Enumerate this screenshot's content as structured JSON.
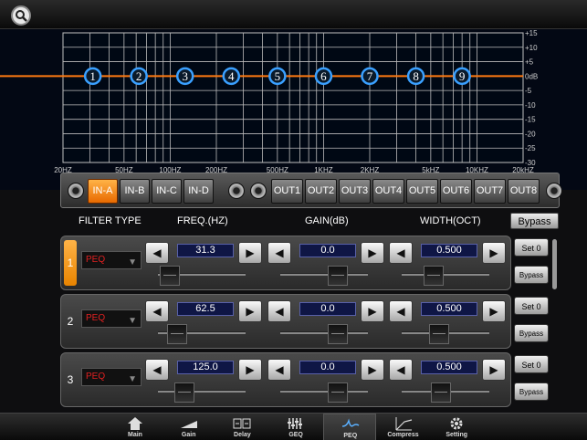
{
  "graph": {
    "db_labels": [
      "+15",
      "+10",
      "+5",
      "0dB",
      "-5",
      "-10",
      "-15",
      "-20",
      "-25",
      "-30"
    ],
    "freq_labels": [
      {
        "label": "20HZ",
        "f": 20
      },
      {
        "label": "50HZ",
        "f": 50
      },
      {
        "label": "100HZ",
        "f": 100
      },
      {
        "label": "200HZ",
        "f": 200
      },
      {
        "label": "500HZ",
        "f": 500
      },
      {
        "label": "1KHZ",
        "f": 1000
      },
      {
        "label": "2KHZ",
        "f": 2000
      },
      {
        "label": "5kHZ",
        "f": 5000
      },
      {
        "label": "10KHZ",
        "f": 10000
      },
      {
        "label": "20kHZ",
        "f": 20000
      }
    ],
    "curve_db": 0,
    "curve_color": "#ff7a10",
    "points": [
      {
        "n": "1",
        "f": 31.3
      },
      {
        "n": "2",
        "f": 62.5
      },
      {
        "n": "3",
        "f": 125
      },
      {
        "n": "4",
        "f": 250
      },
      {
        "n": "5",
        "f": 500
      },
      {
        "n": "6",
        "f": 1000
      },
      {
        "n": "7",
        "f": 2000
      },
      {
        "n": "8",
        "f": 4000
      },
      {
        "n": "9",
        "f": 8000
      }
    ]
  },
  "channels": {
    "inputs": [
      "IN-A",
      "IN-B",
      "IN-C",
      "IN-D"
    ],
    "outputs": [
      "OUT1",
      "OUT2",
      "OUT3",
      "OUT4",
      "OUT5",
      "OUT6",
      "OUT7",
      "OUT8"
    ],
    "active": "IN-A",
    "accent": "#f28a10"
  },
  "headers": {
    "filter_type": "FILTER TYPE",
    "freq": "FREQ.(HZ)",
    "gain": "GAIN(dB)",
    "width": "WIDTH(OCT)",
    "bypass_all": "Bypass"
  },
  "filters": [
    {
      "num": "1",
      "type": "PEQ",
      "freq": "31.3",
      "gain": "0.0",
      "width": "0.500",
      "set": "Set 0",
      "bypass": "Bypass",
      "active": true
    },
    {
      "num": "2",
      "type": "PEQ",
      "freq": "62.5",
      "gain": "0.0",
      "width": "0.500",
      "set": "Set 0",
      "bypass": "Bypass",
      "active": false
    },
    {
      "num": "3",
      "type": "PEQ",
      "freq": "125.0",
      "gain": "0.0",
      "width": "0.500",
      "set": "Set 0",
      "bypass": "Bypass",
      "active": false
    }
  ],
  "nav": [
    {
      "label": "Main",
      "icon": "home-icon"
    },
    {
      "label": "Gain",
      "icon": "gain-ramp-icon"
    },
    {
      "label": "Delay",
      "icon": "delay-icon"
    },
    {
      "label": "GEQ",
      "icon": "geq-icon"
    },
    {
      "label": "PEQ",
      "icon": "peq-icon",
      "active": true
    },
    {
      "label": "Compress",
      "icon": "compress-icon"
    },
    {
      "label": "Setting",
      "icon": "gear-icon"
    }
  ]
}
